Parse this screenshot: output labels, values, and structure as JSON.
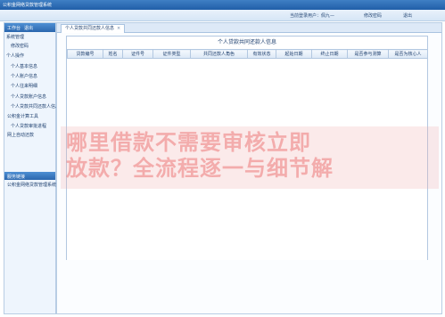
{
  "app": {
    "title": "公积金网络贷款管理系统"
  },
  "userbar": {
    "current_user": "当前登录用户：佩九—",
    "change_password": "修改密码",
    "logout": "退出"
  },
  "sidebar": {
    "tabs": [
      "工作台",
      "退出"
    ],
    "groups": [
      {
        "label": "系统管理",
        "items": [
          "修改密码"
        ]
      },
      {
        "label": "个人操作",
        "items": [
          "个人基本信息",
          "个人账户信息",
          "个人往来明细",
          "个人贷款账户信息",
          "个人贷款共同还款人信息",
          "公积金计算工具",
          "个人贷款审批进程",
          "网上自动还款"
        ]
      }
    ],
    "highlight": "服务链接",
    "bottom_item": "公积金网络贷款管理系统"
  },
  "main": {
    "tab_label": "个人贷款共同还款人信息",
    "panel_title": "个人贷款共同还款人信息",
    "columns": [
      "贷款编号",
      "姓名",
      "证件号",
      "证件类型",
      "共同还款人角色",
      "有效状态",
      "起始日期",
      "终止日期",
      "是否参与测算",
      "是否为核心人"
    ]
  },
  "watermark": {
    "line1": "哪里借款不需要审核立即",
    "line2": "放款？全流程逐一与细节解"
  }
}
